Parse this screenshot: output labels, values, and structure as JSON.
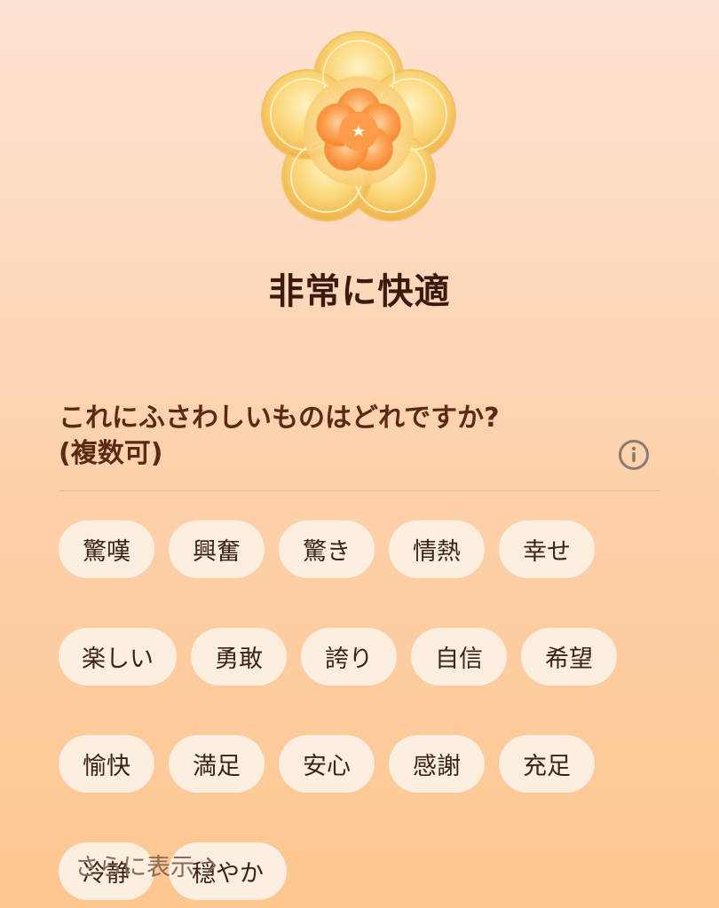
{
  "mood": {
    "title": "非常に快適",
    "flower_icon": "flower-icon"
  },
  "question": {
    "line1": "これにふさわしいものはどれですか?",
    "line2": "(複数可)",
    "info_icon": "info-icon"
  },
  "chips": [
    [
      "驚嘆",
      "興奮",
      "驚き",
      "情熱",
      "幸せ"
    ],
    [
      "楽しい",
      "勇敢",
      "誇り",
      "自信",
      "希望"
    ],
    [
      "愉快",
      "満足",
      "安心",
      "感謝",
      "充足"
    ],
    [
      "冷静",
      "穏やか"
    ]
  ],
  "show_more": {
    "label": "さらに表示",
    "icon": "chevron-right-icon"
  },
  "colors": {
    "background_top": "#fde3d3",
    "background_bottom": "#fdc68f",
    "chip_bg": "#fdeee2",
    "title_text": "#3b1a10",
    "question_text": "#5a2a14"
  }
}
